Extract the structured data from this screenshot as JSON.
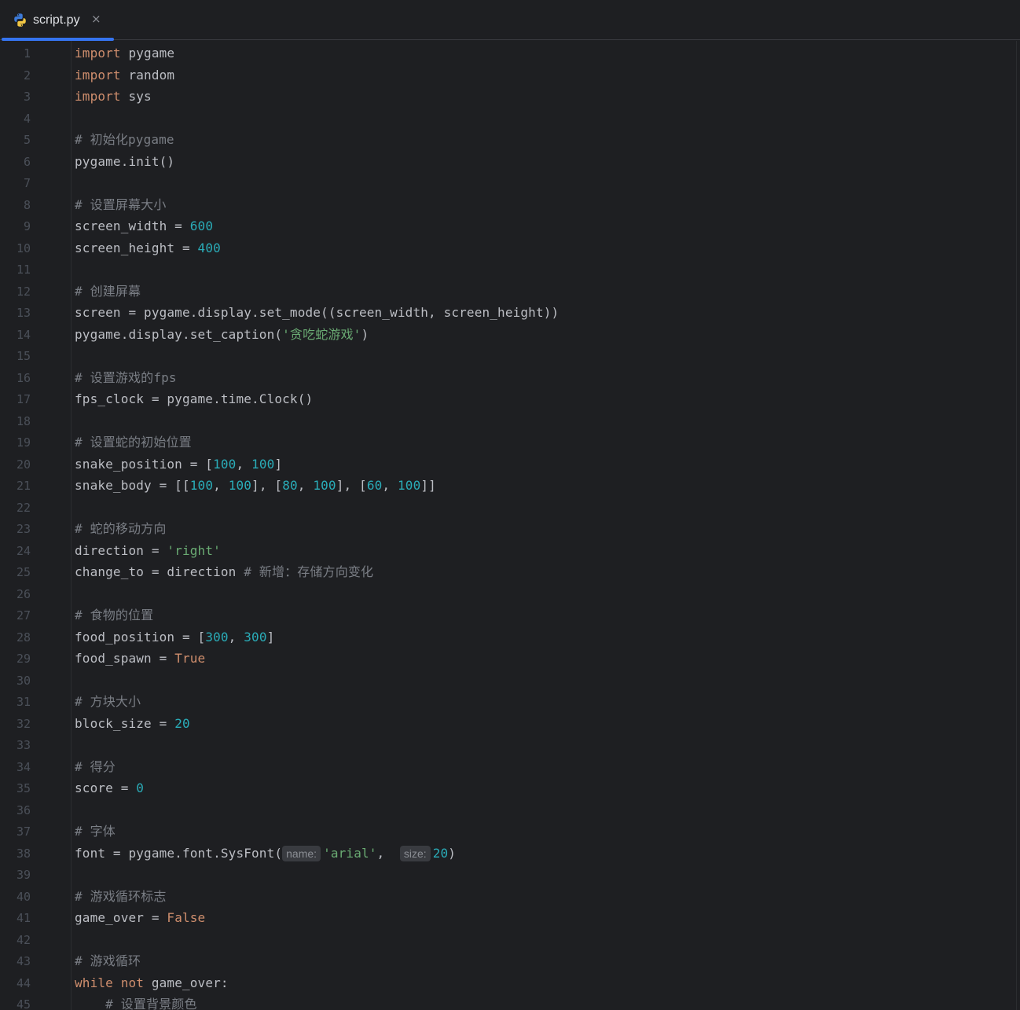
{
  "tab": {
    "filename": "script.py",
    "close_glyph": "×",
    "icon": "python-icon"
  },
  "colors": {
    "background": "#1e1f22",
    "keyword": "#cf8e6d",
    "number": "#2aacb8",
    "string": "#6aab73",
    "comment": "#7a7e85",
    "text": "#bcbec4",
    "line_number": "#4b5059",
    "tab_accent": "#3574f0"
  },
  "lines": [
    {
      "n": "1",
      "tokens": [
        [
          "kw",
          "import"
        ],
        [
          "p",
          " pygame"
        ]
      ]
    },
    {
      "n": "2",
      "tokens": [
        [
          "kw",
          "import"
        ],
        [
          "p",
          " random"
        ]
      ]
    },
    {
      "n": "3",
      "tokens": [
        [
          "kw",
          "import"
        ],
        [
          "p",
          " sys"
        ]
      ]
    },
    {
      "n": "4",
      "tokens": []
    },
    {
      "n": "5",
      "tokens": [
        [
          "cm",
          "# 初始化pygame"
        ]
      ]
    },
    {
      "n": "6",
      "tokens": [
        [
          "p",
          "pygame.init()"
        ]
      ]
    },
    {
      "n": "7",
      "tokens": []
    },
    {
      "n": "8",
      "tokens": [
        [
          "cm",
          "# 设置屏幕大小"
        ]
      ]
    },
    {
      "n": "9",
      "tokens": [
        [
          "p",
          "screen_width = "
        ],
        [
          "num",
          "600"
        ]
      ]
    },
    {
      "n": "10",
      "tokens": [
        [
          "p",
          "screen_height = "
        ],
        [
          "num",
          "400"
        ]
      ]
    },
    {
      "n": "11",
      "tokens": []
    },
    {
      "n": "12",
      "tokens": [
        [
          "cm",
          "# 创建屏幕"
        ]
      ]
    },
    {
      "n": "13",
      "tokens": [
        [
          "p",
          "screen = pygame.display.set_mode((screen_width, screen_height))"
        ]
      ]
    },
    {
      "n": "14",
      "tokens": [
        [
          "p",
          "pygame.display.set_caption("
        ],
        [
          "str",
          "'贪吃蛇游戏'"
        ],
        [
          "p",
          ")"
        ]
      ]
    },
    {
      "n": "15",
      "tokens": []
    },
    {
      "n": "16",
      "tokens": [
        [
          "cm",
          "# 设置游戏的fps"
        ]
      ]
    },
    {
      "n": "17",
      "tokens": [
        [
          "p",
          "fps_clock = pygame.time.Clock()"
        ]
      ]
    },
    {
      "n": "18",
      "tokens": []
    },
    {
      "n": "19",
      "tokens": [
        [
          "cm",
          "# 设置蛇的初始位置"
        ]
      ]
    },
    {
      "n": "20",
      "tokens": [
        [
          "p",
          "snake_position = ["
        ],
        [
          "num",
          "100"
        ],
        [
          "p",
          ", "
        ],
        [
          "num",
          "100"
        ],
        [
          "p",
          "]"
        ]
      ]
    },
    {
      "n": "21",
      "tokens": [
        [
          "p",
          "snake_body = [["
        ],
        [
          "num",
          "100"
        ],
        [
          "p",
          ", "
        ],
        [
          "num",
          "100"
        ],
        [
          "p",
          "], ["
        ],
        [
          "num",
          "80"
        ],
        [
          "p",
          ", "
        ],
        [
          "num",
          "100"
        ],
        [
          "p",
          "], ["
        ],
        [
          "num",
          "60"
        ],
        [
          "p",
          ", "
        ],
        [
          "num",
          "100"
        ],
        [
          "p",
          "]]"
        ]
      ]
    },
    {
      "n": "22",
      "tokens": []
    },
    {
      "n": "23",
      "tokens": [
        [
          "cm",
          "# 蛇的移动方向"
        ]
      ]
    },
    {
      "n": "24",
      "tokens": [
        [
          "p",
          "direction = "
        ],
        [
          "str",
          "'right'"
        ]
      ]
    },
    {
      "n": "25",
      "tokens": [
        [
          "p",
          "change_to = direction "
        ],
        [
          "cm",
          "# 新增：存储方向变化"
        ]
      ]
    },
    {
      "n": "26",
      "tokens": []
    },
    {
      "n": "27",
      "tokens": [
        [
          "cm",
          "# 食物的位置"
        ]
      ]
    },
    {
      "n": "28",
      "tokens": [
        [
          "p",
          "food_position = ["
        ],
        [
          "num",
          "300"
        ],
        [
          "p",
          ", "
        ],
        [
          "num",
          "300"
        ],
        [
          "p",
          "]"
        ]
      ]
    },
    {
      "n": "29",
      "tokens": [
        [
          "p",
          "food_spawn = "
        ],
        [
          "kw",
          "True"
        ]
      ]
    },
    {
      "n": "30",
      "tokens": []
    },
    {
      "n": "31",
      "tokens": [
        [
          "cm",
          "# 方块大小"
        ]
      ]
    },
    {
      "n": "32",
      "tokens": [
        [
          "p",
          "block_size = "
        ],
        [
          "num",
          "20"
        ]
      ]
    },
    {
      "n": "33",
      "tokens": []
    },
    {
      "n": "34",
      "tokens": [
        [
          "cm",
          "# 得分"
        ]
      ]
    },
    {
      "n": "35",
      "tokens": [
        [
          "p",
          "score = "
        ],
        [
          "num",
          "0"
        ]
      ]
    },
    {
      "n": "36",
      "tokens": []
    },
    {
      "n": "37",
      "tokens": [
        [
          "cm",
          "# 字体"
        ]
      ]
    },
    {
      "n": "38",
      "tokens": [
        [
          "p",
          "font = pygame.font.SysFont("
        ],
        [
          "hint",
          "name:"
        ],
        [
          "str",
          "'arial'"
        ],
        [
          "p",
          ",  "
        ],
        [
          "hint",
          "size:"
        ],
        [
          "num",
          "20"
        ],
        [
          "p",
          ")"
        ]
      ]
    },
    {
      "n": "39",
      "tokens": []
    },
    {
      "n": "40",
      "tokens": [
        [
          "cm",
          "# 游戏循环标志"
        ]
      ]
    },
    {
      "n": "41",
      "tokens": [
        [
          "p",
          "game_over = "
        ],
        [
          "kw",
          "False"
        ]
      ]
    },
    {
      "n": "42",
      "tokens": []
    },
    {
      "n": "43",
      "tokens": [
        [
          "cm",
          "# 游戏循环"
        ]
      ]
    },
    {
      "n": "44",
      "tokens": [
        [
          "kw",
          "while"
        ],
        [
          "p",
          " "
        ],
        [
          "kw",
          "not"
        ],
        [
          "p",
          " game_over:"
        ]
      ]
    },
    {
      "n": "45",
      "tokens": [
        [
          "p",
          "    "
        ],
        [
          "cm",
          "# 设置背景颜色"
        ]
      ]
    }
  ]
}
